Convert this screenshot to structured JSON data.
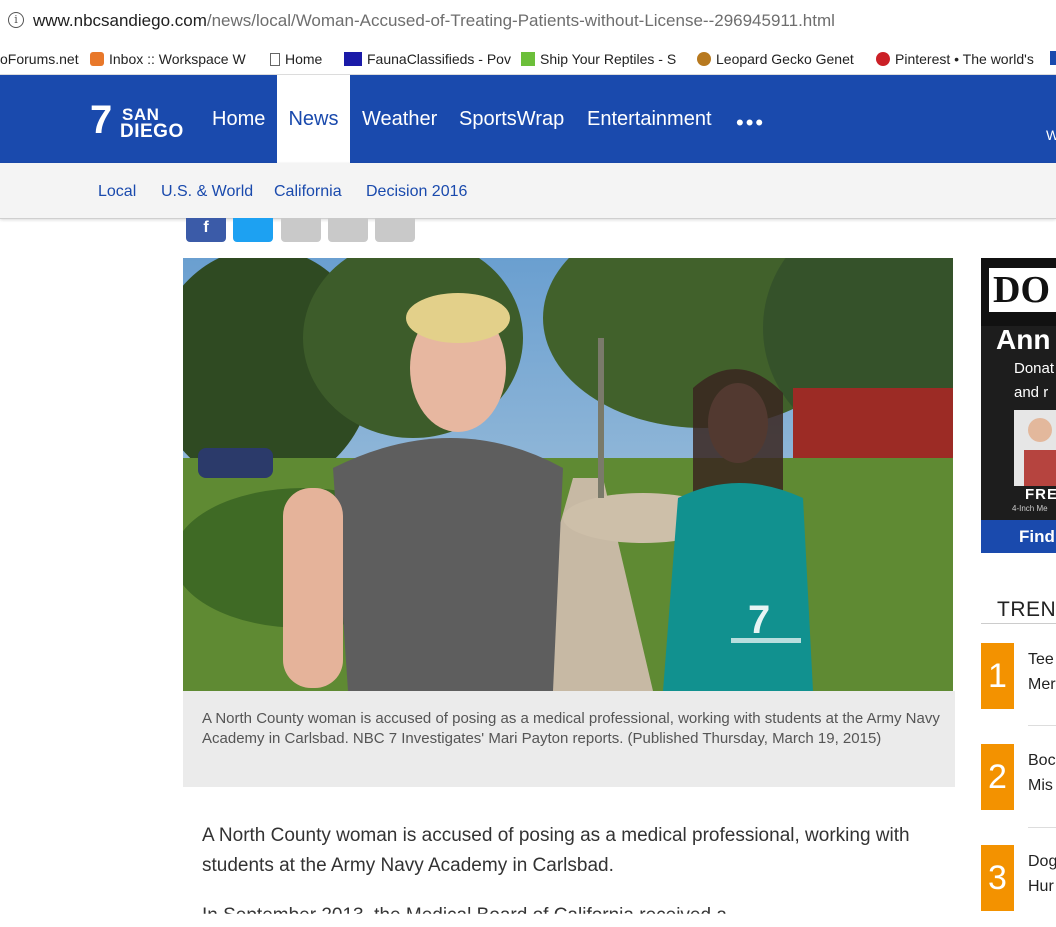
{
  "browser": {
    "url_host": "www.nbcsandiego.com",
    "url_path": "/news/local/Woman-Accused-of-Treating-Patients-without-License--296945911.html",
    "bookmarks": [
      "oForums.net",
      "Inbox :: Workspace W",
      "Home",
      "FaunaClassifieds - Pov",
      "Ship Your Reptiles - S",
      "Leopard Gecko Genet",
      "Pinterest • The world's"
    ]
  },
  "site": {
    "logo_number": "7",
    "logo_line1": "SAN",
    "logo_line2": "DIEGO",
    "nav": [
      "Home",
      "News",
      "Weather",
      "SportsWrap",
      "Entertainment"
    ],
    "nav_more": "•••",
    "nav_right": "W",
    "subnav": [
      "Local",
      "U.S. & World",
      "California",
      "Decision 2016"
    ],
    "active_nav": "News",
    "brand_color": "#1a4aad"
  },
  "article": {
    "caption": "A North County woman is accused of posing as a medical professional, working with students at the Army Navy Academy in Carlsbad. NBC 7 Investigates' Mari Payton reports. (Published Thursday, March 19, 2015)",
    "body": "A North County woman is accused of posing as a medical professional, working with students at the Army Navy Academy in Carlsbad.",
    "body_next": "In September 2013, the Medical Board of California received a"
  },
  "ad": {
    "brand": "DO",
    "headline": "Ann",
    "line1": "Donat",
    "line2": "and r",
    "badge": "FRE",
    "small": "4-Inch Me",
    "cta": "Find"
  },
  "trending": {
    "title": "TREN",
    "items": [
      {
        "num": "1",
        "line1": "Tee",
        "line2": "Mer"
      },
      {
        "num": "2",
        "line1": "Boc",
        "line2": "Mis"
      },
      {
        "num": "3",
        "line1": "Dog",
        "line2": "Hur"
      }
    ],
    "accent": "#f39200"
  }
}
